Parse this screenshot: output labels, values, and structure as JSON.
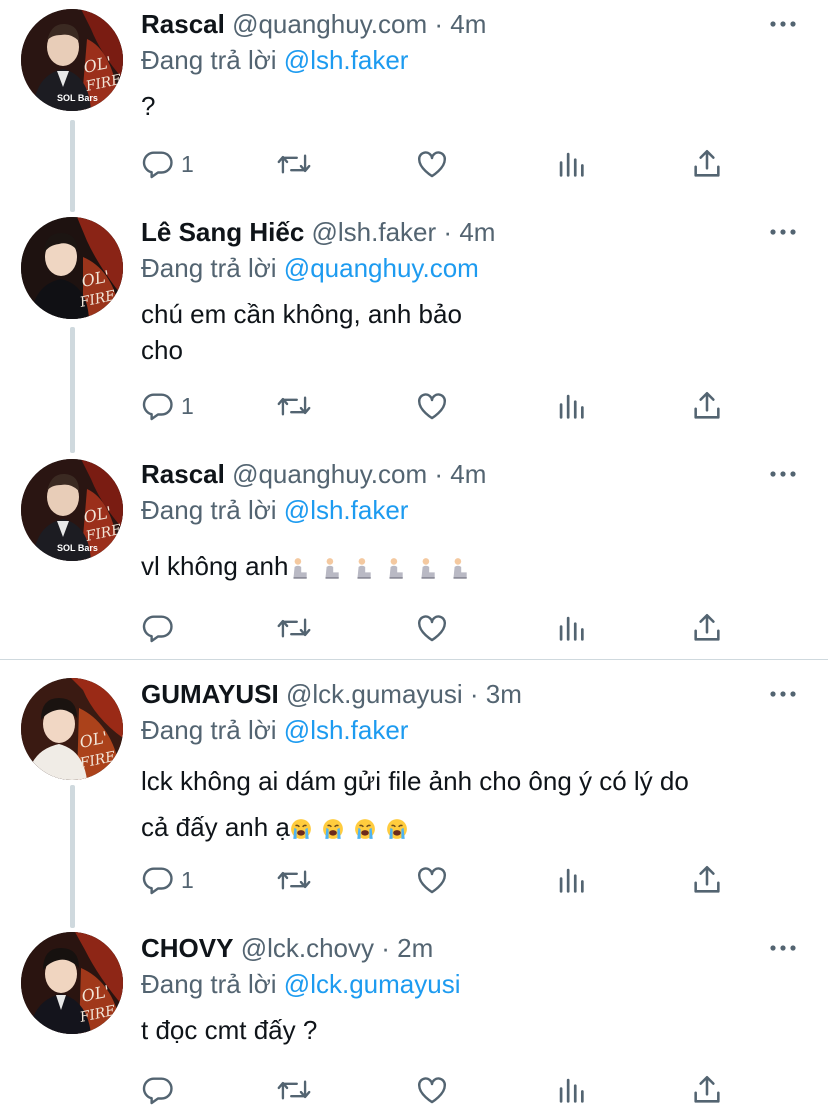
{
  "colors": {
    "accent": "#1d9bf0",
    "muted": "#536471",
    "text": "#0f1419",
    "line": "#cfd9de"
  },
  "tweets": [
    {
      "name": "Rascal",
      "handle": "@quanghuy.com",
      "dot": "·",
      "time": "4m",
      "reply_prefix": "Đang trả lời",
      "reply_to": "@lsh.faker",
      "text": [
        "?"
      ],
      "reply_count": "1",
      "avatar_caption": "SOL Bars"
    },
    {
      "name": "Lê Sang Hiếc",
      "handle": "@lsh.faker",
      "dot": "·",
      "time": "4m",
      "reply_prefix": "Đang trả lời",
      "reply_to": "@quanghuy.com",
      "text": [
        "chú em cần không, anh bảo",
        "cho"
      ],
      "reply_count": "1"
    },
    {
      "name": "Rascal",
      "handle": "@quanghuy.com",
      "dot": "·",
      "time": "4m",
      "reply_prefix": "Đang trả lời",
      "reply_to": "@lsh.faker",
      "text": [
        "vl không anh"
      ],
      "emoji": "person-kneeling-emoji ×6",
      "reply_count": "",
      "avatar_caption": "SOL Bars"
    },
    {
      "name": "GUMAYUSI",
      "handle": "@lck.gumayusi",
      "dot": "·",
      "time": "3m",
      "reply_prefix": "Đang trả lời",
      "reply_to": "@lsh.faker",
      "text": [
        "lck không ai dám gửi file ảnh cho ông ý có lý do",
        "cả đấy anh ạ"
      ],
      "emoji": "loudly-crying-face-emoji ×4",
      "reply_count": "1"
    },
    {
      "name": "CHOVY",
      "handle": "@lck.chovy",
      "dot": "·",
      "time": "2m",
      "reply_prefix": "Đang trả lời",
      "reply_to": "@lck.gumayusi",
      "text": [
        "t đọc cmt đấy ?"
      ],
      "reply_count": ""
    }
  ],
  "avatar_poster_text": "OL' ME BY FIRE",
  "icons": [
    "reply-icon",
    "retweet-icon",
    "like-icon",
    "analytics-icon",
    "share-icon",
    "more-icon"
  ]
}
